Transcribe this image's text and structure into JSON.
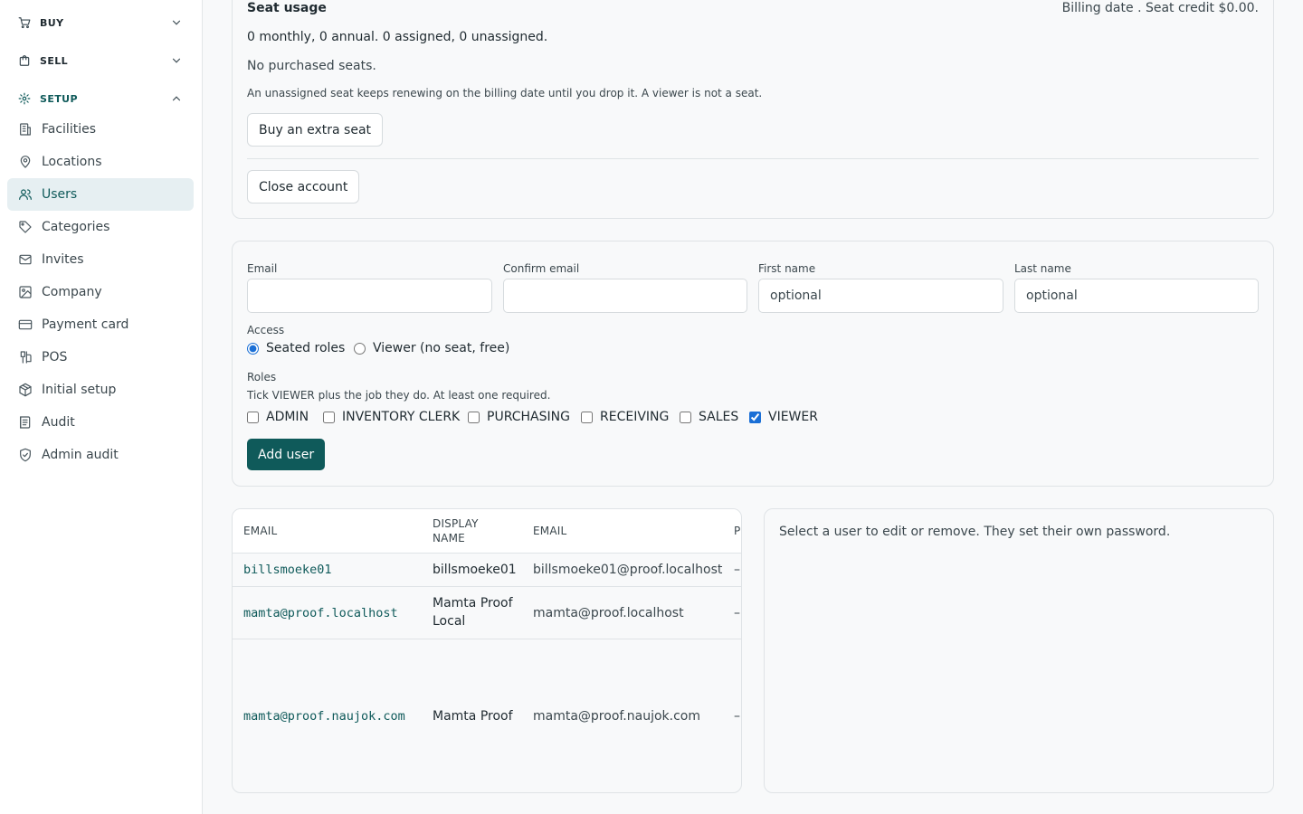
{
  "sidebar": {
    "sections": [
      {
        "label": "BUY"
      },
      {
        "label": "SELL"
      },
      {
        "label": "SETUP"
      }
    ],
    "items": [
      {
        "label": "Facilities"
      },
      {
        "label": "Locations"
      },
      {
        "label": "Users"
      },
      {
        "label": "Categories"
      },
      {
        "label": "Invites"
      },
      {
        "label": "Company"
      },
      {
        "label": "Payment card"
      },
      {
        "label": "POS"
      },
      {
        "label": "Initial setup"
      },
      {
        "label": "Audit"
      },
      {
        "label": "Admin audit"
      }
    ]
  },
  "seat_usage": {
    "title": "Seat usage",
    "billing": "Billing date . Seat credit $0.00.",
    "summary": "0 monthly, 0 annual. 0 assigned, 0 unassigned.",
    "no_seats": "No purchased seats.",
    "note": "An unassigned seat keeps renewing on the billing date until you drop it. A viewer is not a seat.",
    "buy_button": "Buy an extra seat",
    "close_button": "Close account"
  },
  "add_user_form": {
    "email_label": "Email",
    "email_value": "",
    "confirm_email_label": "Confirm email",
    "confirm_email_value": "",
    "first_name_label": "First name",
    "first_name_placeholder": "optional",
    "last_name_label": "Last name",
    "last_name_placeholder": "optional",
    "access_label": "Access",
    "access_options": [
      {
        "label": "Seated roles",
        "selected": true
      },
      {
        "label": "Viewer (no seat, free)",
        "selected": false
      }
    ],
    "roles_label": "Roles",
    "roles_hint": "Tick VIEWER plus the job they do. At least one required.",
    "roles": [
      {
        "label": "ADMIN",
        "checked": false
      },
      {
        "label": "INVENTORY CLERK",
        "checked": false
      },
      {
        "label": "PURCHASING",
        "checked": false
      },
      {
        "label": "RECEIVING",
        "checked": false
      },
      {
        "label": "SALES",
        "checked": false
      },
      {
        "label": "VIEWER",
        "checked": true
      }
    ],
    "submit_button": "Add user"
  },
  "users_table": {
    "headers": [
      "EMAIL",
      "DISPLAY NAME",
      "EMAIL",
      "P"
    ],
    "rows": [
      {
        "login": "billsmoeke01",
        "display_name": "billsmoeke01",
        "email": "billsmoeke01@proof.localhost",
        "p": "–"
      },
      {
        "login": "mamta@proof.localhost",
        "display_name": "Mamta Proof Local",
        "email": "mamta@proof.localhost",
        "p": "–"
      },
      {
        "login": "mamta@proof.naujok.com",
        "display_name": "Mamta Proof",
        "email": "mamta@proof.naujok.com",
        "p": "–"
      }
    ]
  },
  "detail_panel": {
    "hint": "Select a user to edit or remove. They set their own password."
  }
}
